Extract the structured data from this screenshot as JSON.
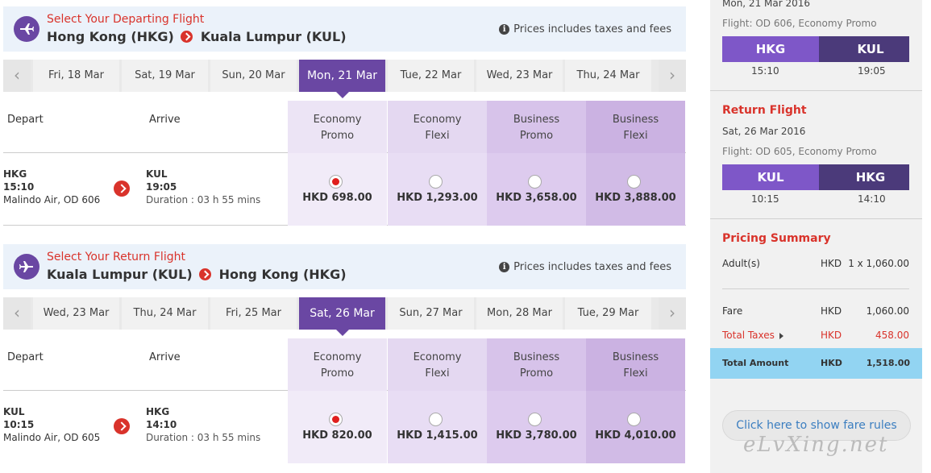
{
  "departing": {
    "label": "Select Your Departing Flight",
    "origin": "Hong Kong (HKG)",
    "destination": "Kuala Lumpur (KUL)",
    "note": "Prices includes taxes and fees",
    "dates": [
      "Fri, 18 Mar",
      "Sat, 19 Mar",
      "Sun, 20 Mar",
      "Mon, 21 Mar",
      "Tue, 22 Mar",
      "Wed, 23 Mar",
      "Thu, 24 Mar"
    ],
    "selected_date_index": 3,
    "depart_label": "Depart",
    "arrive_label": "Arrive",
    "fares": [
      {
        "line1": "Economy",
        "line2": "Promo",
        "price": "HKD 698.00",
        "selected": true
      },
      {
        "line1": "Economy",
        "line2": "Flexi",
        "price": "HKD 1,293.00",
        "selected": false
      },
      {
        "line1": "Business",
        "line2": "Promo",
        "price": "HKD 3,658.00",
        "selected": false
      },
      {
        "line1": "Business",
        "line2": "Flexi",
        "price": "HKD 3,888.00",
        "selected": false
      }
    ],
    "flight": {
      "dep_code": "HKG",
      "dep_time": "15:10",
      "carrier": "Malindo Air, OD 606",
      "arr_code": "KUL",
      "arr_time": "19:05",
      "duration": "Duration : 03 h 55 mins"
    }
  },
  "returning": {
    "label": "Select Your Return Flight",
    "origin": "Kuala Lumpur (KUL)",
    "destination": "Hong Kong (HKG)",
    "note": "Prices includes taxes and fees",
    "dates": [
      "Wed, 23 Mar",
      "Thu, 24 Mar",
      "Fri, 25 Mar",
      "Sat, 26 Mar",
      "Sun, 27 Mar",
      "Mon, 28 Mar",
      "Tue, 29 Mar"
    ],
    "selected_date_index": 3,
    "depart_label": "Depart",
    "arrive_label": "Arrive",
    "fares": [
      {
        "line1": "Economy",
        "line2": "Promo",
        "price": "HKD 820.00",
        "selected": true
      },
      {
        "line1": "Economy",
        "line2": "Flexi",
        "price": "HKD 1,415.00",
        "selected": false
      },
      {
        "line1": "Business",
        "line2": "Promo",
        "price": "HKD 3,780.00",
        "selected": false
      },
      {
        "line1": "Business",
        "line2": "Flexi",
        "price": "HKD 4,010.00",
        "selected": false
      }
    ],
    "flight": {
      "dep_code": "KUL",
      "dep_time": "10:15",
      "carrier": "Malindo Air, OD 605",
      "arr_code": "HKG",
      "arr_time": "14:10",
      "duration": "Duration : 03 h 55 mins"
    }
  },
  "sidebar": {
    "depart": {
      "date": "Mon, 21 Mar 2016",
      "flight": "Flight: OD 606, Economy Promo",
      "from": "HKG",
      "to": "KUL",
      "from_time": "15:10",
      "to_time": "19:05"
    },
    "return": {
      "title": "Return Flight",
      "date": "Sat, 26 Mar 2016",
      "flight": "Flight: OD 605, Economy Promo",
      "from": "KUL",
      "to": "HKG",
      "from_time": "10:15",
      "to_time": "14:10"
    },
    "pricing": {
      "title": "Pricing Summary",
      "adults_label": "Adult(s)",
      "adults_cur": "HKD",
      "adults_value": "1 x 1,060.00",
      "fare_label": "Fare",
      "fare_cur": "HKD",
      "fare_value": "1,060.00",
      "tax_label": "Total Taxes",
      "tax_cur": "HKD",
      "tax_value": "458.00",
      "total_label": "Total Amount",
      "total_cur": "HKD",
      "total_value": "1,518.00"
    },
    "rules_button": "Click here to show fare rules"
  },
  "watermark": "eLvXing.net",
  "colors": {
    "accent": "#6a47a3",
    "alert": "#d9332b",
    "total_bg": "#92d4f2"
  }
}
